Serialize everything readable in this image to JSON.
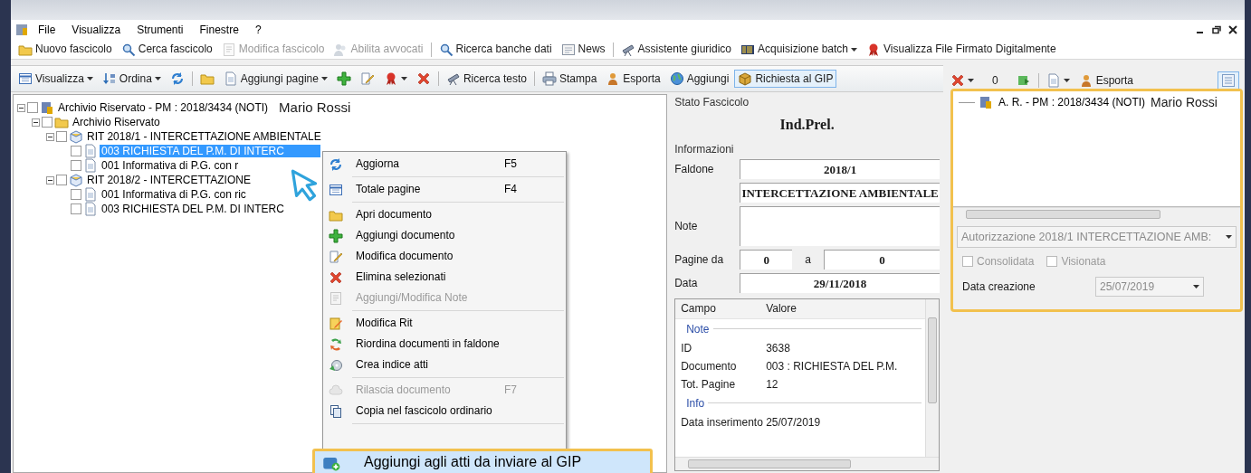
{
  "menu_bar": [
    {
      "label": "File"
    },
    {
      "label": "Visualizza"
    },
    {
      "label": "Strumenti"
    },
    {
      "label": "Finestre"
    },
    {
      "label": "?"
    }
  ],
  "main_toolbar": [
    {
      "kind": "button",
      "label": "Nuovo fascicolo",
      "disabled": false,
      "dropdown": false
    },
    {
      "kind": "button",
      "label": "Cerca fascicolo",
      "disabled": false,
      "dropdown": false
    },
    {
      "kind": "button",
      "label": "Modifica fascicolo",
      "disabled": true,
      "dropdown": false
    },
    {
      "kind": "button",
      "label": "Abilita avvocati",
      "disabled": true,
      "dropdown": false
    },
    {
      "kind": "separator"
    },
    {
      "kind": "button",
      "label": "Ricerca banche dati",
      "disabled": false,
      "dropdown": false
    },
    {
      "kind": "button",
      "label": "News",
      "disabled": false,
      "dropdown": false
    },
    {
      "kind": "separator"
    },
    {
      "kind": "button",
      "label": "Assistente giuridico",
      "disabled": false,
      "dropdown": false
    },
    {
      "kind": "button",
      "label": "Acquisizione batch",
      "disabled": false,
      "dropdown": true
    },
    {
      "kind": "button",
      "label": "Visualizza File Firmato Digitalmente",
      "disabled": false,
      "dropdown": false
    }
  ],
  "document_toolbar": [
    {
      "kind": "button",
      "label": "Visualizza",
      "dropdown": true,
      "pressed": false
    },
    {
      "kind": "button",
      "label": "Ordina",
      "dropdown": true,
      "pressed": false
    },
    {
      "kind": "icon",
      "dropdown": false,
      "pressed": false
    },
    {
      "kind": "separator"
    },
    {
      "kind": "icon",
      "dropdown": false,
      "pressed": false
    },
    {
      "kind": "button",
      "label": "Aggiungi pagine",
      "dropdown": true,
      "pressed": false
    },
    {
      "kind": "icon",
      "dropdown": false,
      "pressed": false
    },
    {
      "kind": "icon",
      "dropdown": false,
      "pressed": false
    },
    {
      "kind": "icon",
      "dropdown": true,
      "pressed": false
    },
    {
      "kind": "icon",
      "dropdown": false,
      "pressed": false
    },
    {
      "kind": "separator"
    },
    {
      "kind": "button",
      "label": "Ricerca testo",
      "dropdown": false,
      "pressed": false
    },
    {
      "kind": "separator"
    },
    {
      "kind": "button",
      "label": "Stampa",
      "dropdown": false,
      "pressed": false
    },
    {
      "kind": "button",
      "label": "Esporta",
      "dropdown": false,
      "pressed": false
    },
    {
      "kind": "button",
      "label": "Aggiungi",
      "dropdown": false,
      "pressed": false
    },
    {
      "kind": "button",
      "label": "Richiesta al GIP",
      "dropdown": false,
      "pressed": true
    }
  ],
  "tree": [
    {
      "kind": "archive",
      "label": "Archivio Riservato - PM : 2018/3434 (NOTI)",
      "owner": "Mario Rossi",
      "checked": false,
      "selected": false,
      "expanded": true,
      "children": [
        {
          "kind": "folder",
          "label": "Archivio Riservato",
          "checked": false,
          "selected": false,
          "expanded": true,
          "children": [
            {
              "kind": "rit",
              "label": "RIT 2018/1 - INTERCETTAZIONE AMBIENTALE",
              "checked": false,
              "selected": false,
              "expanded": true,
              "children": [
                {
                  "kind": "document",
                  "label": "003 RICHIESTA DEL P.M. DI INTERC",
                  "checked": false,
                  "selected": true
                },
                {
                  "kind": "document",
                  "label": "001 Informativa di P.G. con r",
                  "checked": false,
                  "selected": false
                }
              ]
            },
            {
              "kind": "rit",
              "label": "RIT 2018/2 - INTERCETTAZIONE",
              "checked": false,
              "selected": false,
              "expanded": true,
              "children": [
                {
                  "kind": "document",
                  "label": "001 Informativa di P.G. con ric",
                  "checked": false,
                  "selected": false
                },
                {
                  "kind": "document",
                  "label": "003 RICHIESTA DEL P.M. DI INTERC",
                  "checked": false,
                  "selected": false
                }
              ]
            }
          ]
        }
      ]
    }
  ],
  "context_menu": [
    {
      "kind": "item",
      "label": "Aggiorna",
      "shortcut": "F5",
      "disabled": false
    },
    {
      "kind": "separator"
    },
    {
      "kind": "item",
      "label": "Totale pagine",
      "shortcut": "F4",
      "disabled": false
    },
    {
      "kind": "separator"
    },
    {
      "kind": "item",
      "label": "Apri documento",
      "disabled": false
    },
    {
      "kind": "item",
      "label": "Aggiungi documento",
      "disabled": false
    },
    {
      "kind": "item",
      "label": "Modifica documento",
      "disabled": false
    },
    {
      "kind": "item",
      "label": "Elimina selezionati",
      "disabled": false
    },
    {
      "kind": "item",
      "label": "Aggiungi/Modifica Note",
      "disabled": true
    },
    {
      "kind": "separator"
    },
    {
      "kind": "item",
      "label": "Modifica Rit",
      "disabled": false
    },
    {
      "kind": "item",
      "label": "Riordina documenti in faldone",
      "disabled": false
    },
    {
      "kind": "item",
      "label": "Crea indice atti",
      "disabled": false
    },
    {
      "kind": "separator"
    },
    {
      "kind": "item",
      "label": "Rilascia documento",
      "shortcut": "F7",
      "disabled": true
    },
    {
      "kind": "item",
      "label": "Copia nel fascicolo ordinario",
      "disabled": false
    },
    {
      "kind": "separator"
    }
  ],
  "highlighted_action": {
    "label": "Aggiungi agli atti da inviare al GIP"
  },
  "details": {
    "status_title": "Stato Fascicolo",
    "status": "Ind.Prel.",
    "info_title": "Informazioni",
    "faldone": {
      "label": "Faldone",
      "value": "2018/1",
      "description": "INTERCETTAZIONE AMBIENTALE"
    },
    "note": {
      "label": "Note"
    },
    "pages": {
      "label": "Pagine da",
      "from": "0",
      "between": "a",
      "to": "0"
    },
    "date": {
      "label": "Data",
      "value": "29/11/2018"
    },
    "property_grid": {
      "columns": [
        "Campo",
        "Valore"
      ],
      "sections": [
        {
          "title": "Note",
          "rows": [
            {
              "field": "ID",
              "value": "3638"
            },
            {
              "field": "Documento",
              "value": "003 : RICHIESTA DEL P.M."
            },
            {
              "field": "Tot. Pagine",
              "value": "12"
            }
          ]
        },
        {
          "title": "Info",
          "rows": [
            {
              "field": "Data inserimento",
              "value": "25/07/2019"
            }
          ]
        }
      ]
    }
  },
  "side_toolbar": [
    {
      "kind": "icon",
      "dropdown": true
    },
    {
      "kind": "text",
      "label": "0"
    },
    {
      "kind": "icon",
      "dropdown": false
    },
    {
      "kind": "separator"
    },
    {
      "kind": "icon",
      "dropdown": true
    },
    {
      "kind": "button",
      "label": "Esporta"
    }
  ],
  "side_panel": {
    "tree": [
      {
        "label": "A. R. - PM : 2018/3434 (NOTI)",
        "owner": "Mario Rossi",
        "selected": false
      }
    ],
    "authorization": {
      "value": "Autorizzazione 2018/1 INTERCETTAZIONE AMB:",
      "disabled": true
    },
    "checkboxes": [
      {
        "label": "Consolidata",
        "checked": false,
        "disabled": true
      },
      {
        "label": "Visionata",
        "checked": false,
        "disabled": true
      }
    ],
    "creation_date": {
      "label": "Data creazione",
      "value": "25/07/2019",
      "disabled": true
    }
  }
}
